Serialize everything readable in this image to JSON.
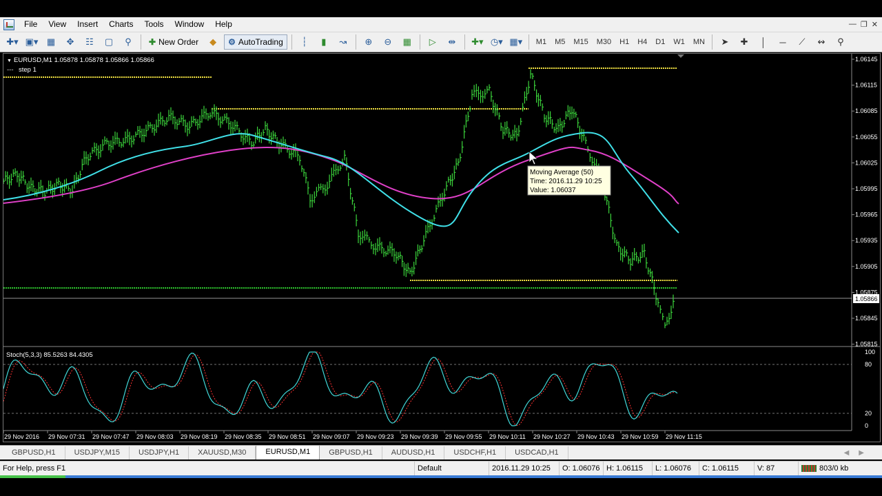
{
  "menu": [
    "File",
    "View",
    "Insert",
    "Charts",
    "Tools",
    "Window",
    "Help"
  ],
  "toolbar": {
    "new_order": "New Order",
    "autotrading": "AutoTrading",
    "timeframes": [
      "M1",
      "M5",
      "M15",
      "M30",
      "H1",
      "H4",
      "D1",
      "W1",
      "MN"
    ]
  },
  "chart": {
    "header": "EURUSD,M1  1.05878 1.05878 1.05866 1.05866",
    "step_label": "step 1",
    "price_labels": [
      "1.06145",
      "1.06115",
      "1.06085",
      "1.06055",
      "1.06025",
      "1.05995",
      "1.05965",
      "1.05935",
      "1.05905",
      "1.05875",
      "1.05845",
      "1.05815"
    ],
    "current_price": "1.05866",
    "tooltip": [
      "Moving Average (50)",
      "Time: 2016.11.29 10:25",
      "Value: 1.06037"
    ],
    "stoch_header": "Stoch(5,3,3) 85.5263 84.4305",
    "stoch_levels": [
      "100",
      "80",
      "20",
      "0"
    ],
    "time_labels": [
      "29 Nov 2016",
      "29 Nov 07:31",
      "29 Nov 07:47",
      "29 Nov 08:03",
      "29 Nov 08:19",
      "29 Nov 08:35",
      "29 Nov 08:51",
      "29 Nov 09:07",
      "29 Nov 09:23",
      "29 Nov 09:39",
      "29 Nov 09:55",
      "29 Nov 10:11",
      "29 Nov 10:27",
      "29 Nov 10:43",
      "29 Nov 10:59",
      "29 Nov 11:15"
    ],
    "colors": {
      "bars": "#3bd43b",
      "ma_fast": "#40e0e8",
      "ma_slow": "#e040c8",
      "levels": "#f0e040",
      "green_level": "#2ec42e",
      "stoch_main": "#40d8d8",
      "stoch_signal": "#ff3030"
    }
  },
  "tabs": [
    "GBPUSD,H1",
    "USDJPY,M15",
    "USDJPY,H1",
    "XAUUSD,M30",
    "EURUSD,M1",
    "GBPUSD,H1",
    "AUDUSD,H1",
    "USDCHF,H1",
    "USDCAD,H1"
  ],
  "active_tab": "EURUSD,M1",
  "status": {
    "help": "For Help, press F1",
    "profile": "Default",
    "time": "2016.11.29 10:25",
    "open": "O: 1.06076",
    "high": "H: 1.06115",
    "low": "L: 1.06076",
    "close": "C: 1.06115",
    "volume": "V: 87",
    "traffic": "803/0 kb"
  }
}
